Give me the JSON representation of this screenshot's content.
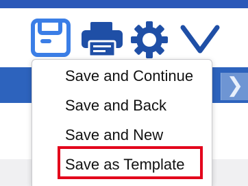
{
  "toolbar": {
    "icons": [
      "save-icon",
      "print-icon",
      "gear-icon",
      "chevron-down-icon"
    ],
    "accent_color": "#2d63bd"
  },
  "nav": {
    "next_glyph": "❯"
  },
  "save_menu": {
    "items": [
      {
        "label": "Save and Continue"
      },
      {
        "label": "Save and Back"
      },
      {
        "label": "Save and New"
      },
      {
        "label": "Save as Template"
      }
    ],
    "highlight_color": "#e3001b"
  }
}
